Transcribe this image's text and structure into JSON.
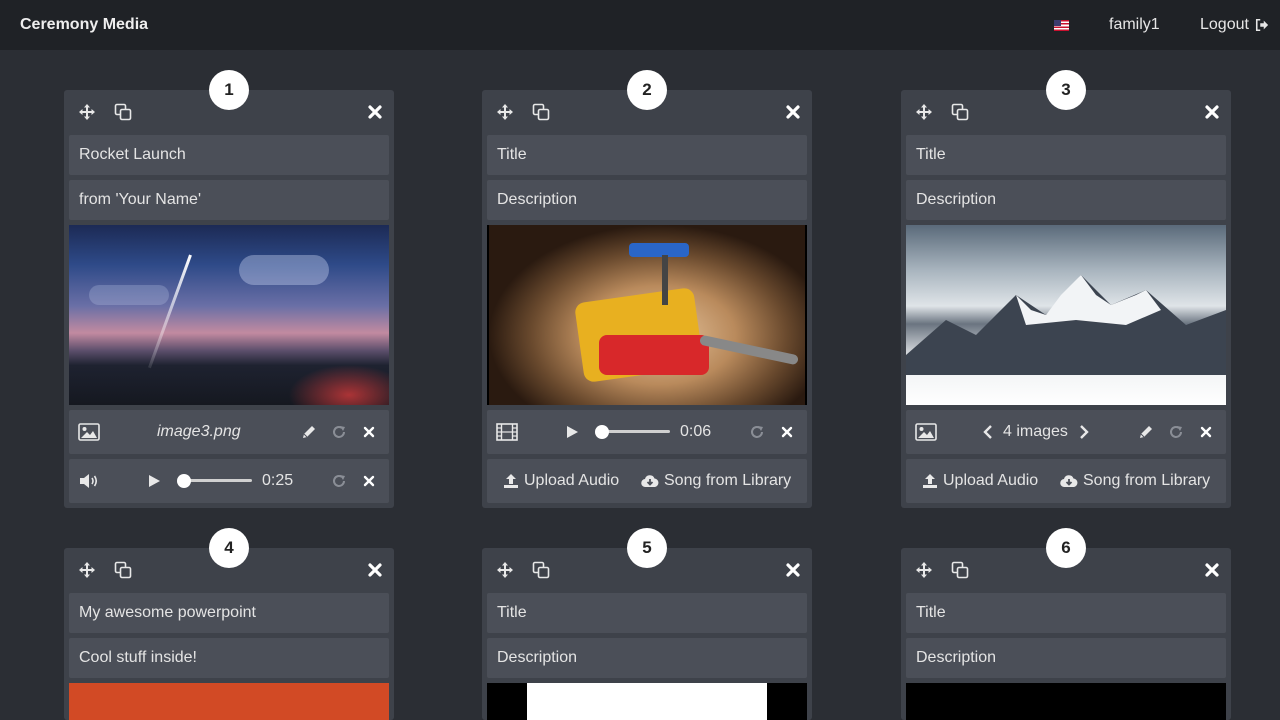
{
  "navbar": {
    "brand": "Ceremony Media",
    "flag_icon": "us-flag-icon",
    "username": "family1",
    "logout_label": "Logout"
  },
  "cards": [
    {
      "number": "1",
      "title": "Rocket Launch",
      "description": "from 'Your Name'",
      "media_type": "image",
      "media_label": "image3.png",
      "audio_time": "0:25"
    },
    {
      "number": "2",
      "title_placeholder": "Title",
      "description_placeholder": "Description",
      "media_type": "video",
      "video_time": "0:06",
      "upload_audio_label": "Upload Audio",
      "song_library_label": "Song from Library"
    },
    {
      "number": "3",
      "title_placeholder": "Title",
      "description_placeholder": "Description",
      "media_type": "gallery",
      "media_label": "4 images",
      "upload_audio_label": "Upload Audio",
      "song_library_label": "Song from Library"
    },
    {
      "number": "4",
      "title": "My awesome powerpoint",
      "description": "Cool stuff inside!"
    },
    {
      "number": "5",
      "title_placeholder": "Title",
      "description_placeholder": "Description"
    },
    {
      "number": "6",
      "title_placeholder": "Title",
      "description_placeholder": "Description"
    }
  ],
  "colors": {
    "background": "#2b2e34",
    "navbar": "#1f2226",
    "card": "#3e424a",
    "field": "#4b4f58"
  }
}
